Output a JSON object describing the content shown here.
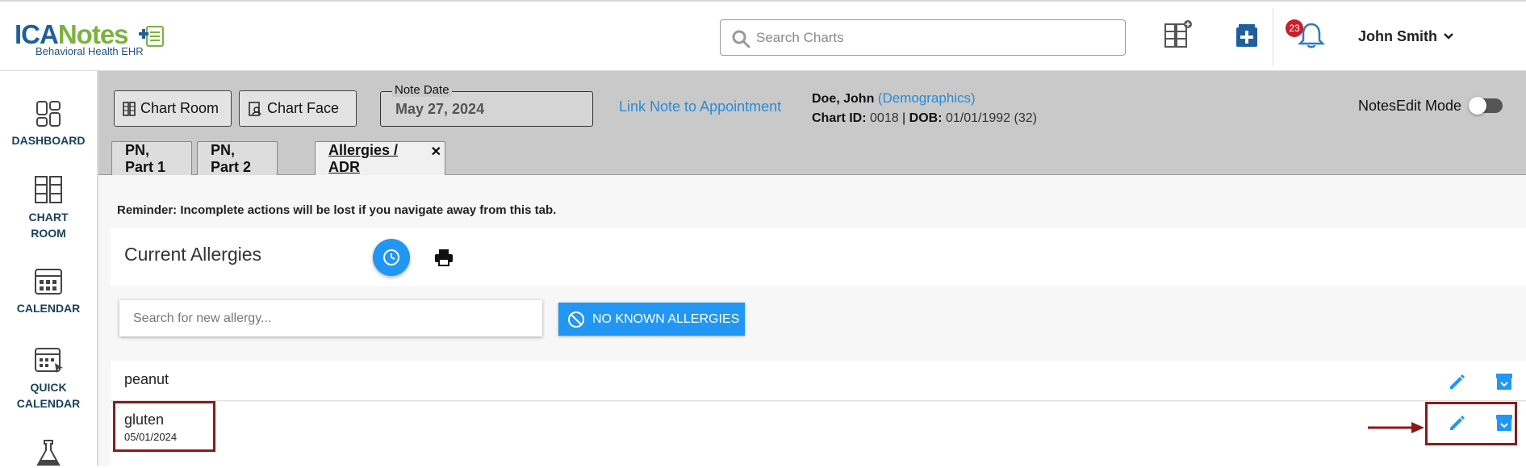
{
  "header": {
    "logo_text_1": "ICA",
    "logo_text_2": "Notes",
    "logo_subtitle": "Behavioral Health EHR",
    "search_placeholder": "Search Charts",
    "notification_count": "23",
    "user_name": "John Smith"
  },
  "sidebar": {
    "items": [
      {
        "label": "DASHBOARD",
        "icon": "dashboard-icon"
      },
      {
        "label": "CHART\nROOM",
        "icon": "chart-room-icon"
      },
      {
        "label": "CALENDAR",
        "icon": "calendar-icon"
      },
      {
        "label": "QUICK\nCALENDAR",
        "icon": "quick-calendar-icon"
      }
    ]
  },
  "toolbar": {
    "chart_room_label": "Chart Room",
    "chart_face_label": "Chart Face",
    "note_date_label": "Note Date",
    "note_date_value": "May 27, 2024",
    "link_appointment": "Link Note to Appointment",
    "notes_edit_mode": "NotesEdit Mode"
  },
  "patient": {
    "name": "Doe, John",
    "demographics_link": "(Demographics)",
    "chart_id_label": "Chart ID:",
    "chart_id": "0018",
    "dob_label": "DOB:",
    "dob": "01/01/1992 (32)"
  },
  "tabs": [
    {
      "label": "PN, Part 1",
      "active": false
    },
    {
      "label": "PN, Part 2",
      "active": false
    },
    {
      "label": "Allergies / ADR",
      "active": true
    }
  ],
  "main": {
    "reminder": "Reminder: Incomplete actions will be lost if you navigate away from this tab.",
    "section_title": "Current Allergies",
    "new_allergy_placeholder": "Search for new allergy...",
    "no_known_allergies": "NO KNOWN ALLERGIES",
    "allergies": [
      {
        "name": "peanut",
        "date": ""
      },
      {
        "name": "gluten",
        "date": "05/01/2024"
      }
    ]
  },
  "colors": {
    "accent": "#2196f3",
    "link": "#2a8bd8",
    "highlight_box": "#8b1a1a",
    "badge": "#c8202a"
  }
}
